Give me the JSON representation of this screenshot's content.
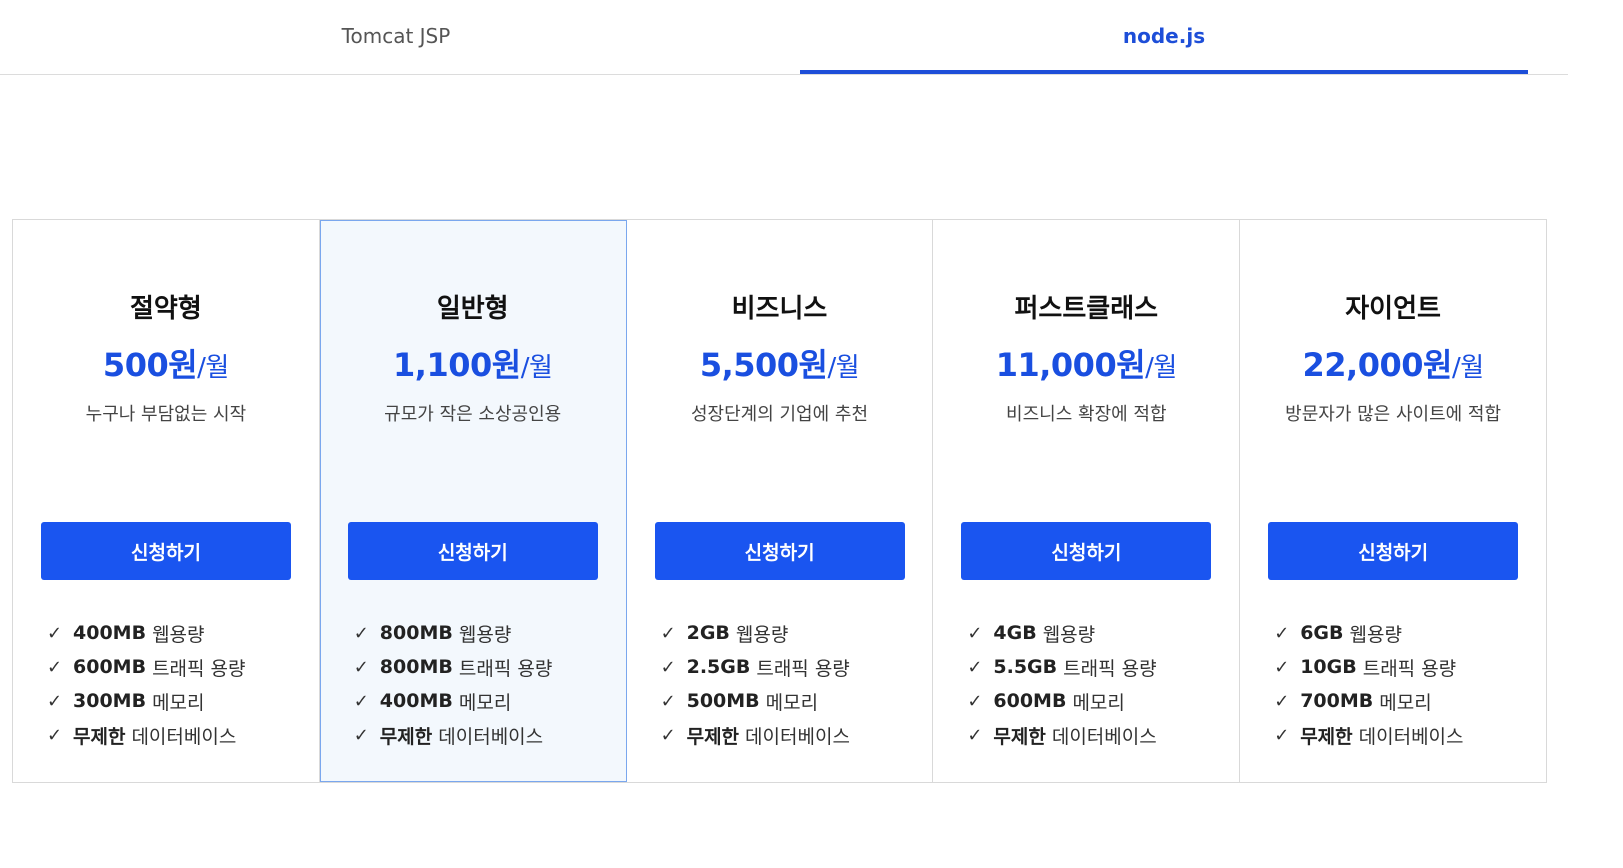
{
  "tabs": [
    {
      "label": "Tomcat JSP",
      "active": false
    },
    {
      "label": "node.js",
      "active": true
    }
  ],
  "accent_color": "#1a55f0",
  "plans": [
    {
      "name": "절약형",
      "price": "500원",
      "per": "/월",
      "description": "누구나 부담없는 시작",
      "button_label": "신청하기",
      "featured": false,
      "features": [
        {
          "value": "400MB",
          "label": "웹용량"
        },
        {
          "value": "600MB",
          "label": "트래픽 용량"
        },
        {
          "value": "300MB",
          "label": "메모리"
        },
        {
          "value": "무제한",
          "label": "데이터베이스"
        }
      ]
    },
    {
      "name": "일반형",
      "price": "1,100원",
      "per": "/월",
      "description": "규모가 작은 소상공인용",
      "button_label": "신청하기",
      "featured": true,
      "features": [
        {
          "value": "800MB",
          "label": "웹용량"
        },
        {
          "value": "800MB",
          "label": "트래픽 용량"
        },
        {
          "value": "400MB",
          "label": "메모리"
        },
        {
          "value": "무제한",
          "label": "데이터베이스"
        }
      ]
    },
    {
      "name": "비즈니스",
      "price": "5,500원",
      "per": "/월",
      "description": "성장단계의 기업에 추천",
      "button_label": "신청하기",
      "featured": false,
      "features": [
        {
          "value": "2GB",
          "label": "웹용량"
        },
        {
          "value": "2.5GB",
          "label": "트래픽 용량"
        },
        {
          "value": "500MB",
          "label": "메모리"
        },
        {
          "value": "무제한",
          "label": "데이터베이스"
        }
      ]
    },
    {
      "name": "퍼스트클래스",
      "price": "11,000원",
      "per": "/월",
      "description": "비즈니스 확장에 적합",
      "button_label": "신청하기",
      "featured": false,
      "features": [
        {
          "value": "4GB",
          "label": "웹용량"
        },
        {
          "value": "5.5GB",
          "label": "트래픽 용량"
        },
        {
          "value": "600MB",
          "label": "메모리"
        },
        {
          "value": "무제한",
          "label": "데이터베이스"
        }
      ]
    },
    {
      "name": "자이언트",
      "price": "22,000원",
      "per": "/월",
      "description": "방문자가 많은 사이트에 적합",
      "button_label": "신청하기",
      "featured": false,
      "features": [
        {
          "value": "6GB",
          "label": "웹용량"
        },
        {
          "value": "10GB",
          "label": "트래픽 용량"
        },
        {
          "value": "700MB",
          "label": "메모리"
        },
        {
          "value": "무제한",
          "label": "데이터베이스"
        }
      ]
    }
  ]
}
